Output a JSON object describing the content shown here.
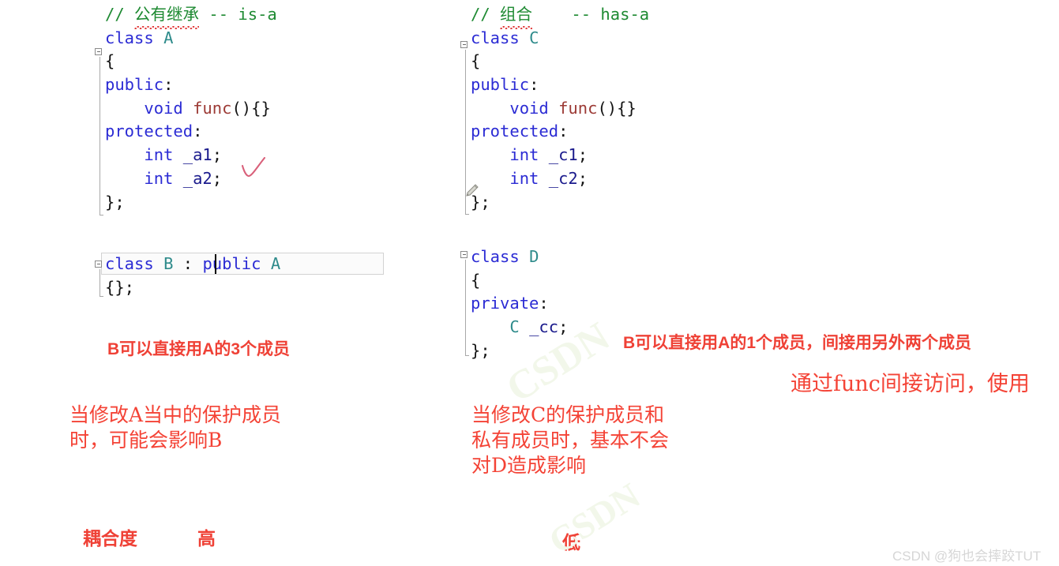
{
  "left_panel": {
    "class_a": {
      "lines": [
        {
          "indent": 0,
          "tokens": [
            {
              "t": "// ",
              "c": "comment"
            },
            {
              "t": "公有继承",
              "c": "comment",
              "squiggle": true
            },
            {
              "t": " -- is-a",
              "c": "comment"
            }
          ]
        },
        {
          "indent": 0,
          "tokens": [
            {
              "t": "class ",
              "c": "keyword"
            },
            {
              "t": "A",
              "c": "type"
            }
          ]
        },
        {
          "indent": 0,
          "tokens": [
            {
              "t": "{",
              "c": "punct"
            }
          ]
        },
        {
          "indent": 0,
          "tokens": [
            {
              "t": "public",
              "c": "keyword"
            },
            {
              "t": ":",
              "c": "punct"
            }
          ]
        },
        {
          "indent": 0,
          "tokens": [
            {
              "t": "    ",
              "c": "plain"
            },
            {
              "t": "void",
              "c": "keyword"
            },
            {
              "t": " ",
              "c": "plain"
            },
            {
              "t": "func",
              "c": "func"
            },
            {
              "t": "(){}",
              "c": "punct"
            }
          ]
        },
        {
          "indent": 0,
          "tokens": [
            {
              "t": "protected",
              "c": "keyword"
            },
            {
              "t": ":",
              "c": "punct"
            }
          ]
        },
        {
          "indent": 0,
          "tokens": [
            {
              "t": "    ",
              "c": "plain"
            },
            {
              "t": "int",
              "c": "keyword"
            },
            {
              "t": " ",
              "c": "plain"
            },
            {
              "t": "_a1",
              "c": "ident"
            },
            {
              "t": ";",
              "c": "punct"
            }
          ]
        },
        {
          "indent": 0,
          "tokens": [
            {
              "t": "    ",
              "c": "plain"
            },
            {
              "t": "int",
              "c": "keyword"
            },
            {
              "t": " ",
              "c": "plain"
            },
            {
              "t": "_a2",
              "c": "ident"
            },
            {
              "t": ";",
              "c": "punct"
            }
          ]
        },
        {
          "indent": 0,
          "tokens": [
            {
              "t": "};",
              "c": "punct"
            }
          ]
        }
      ]
    },
    "class_b": {
      "lines": [
        {
          "indent": 0,
          "tokens": [
            {
              "t": "class ",
              "c": "keyword"
            },
            {
              "t": "B",
              "c": "type"
            },
            {
              "t": " : ",
              "c": "punct"
            },
            {
              "t": "public",
              "c": "keyword"
            },
            {
              "t": " ",
              "c": "plain"
            },
            {
              "t": "A",
              "c": "type"
            }
          ]
        },
        {
          "indent": 0,
          "tokens": [
            {
              "t": "{};",
              "c": "punct"
            }
          ]
        }
      ],
      "caret_after": "p"
    },
    "annotation_members": "B可以直接用A的3个成员",
    "annotation_effect": "当修改A当中的保护成员\n时，可能会影响B",
    "coupling_label": "耦合度",
    "coupling_value": "高"
  },
  "right_panel": {
    "class_c": {
      "lines": [
        {
          "indent": 0,
          "tokens": [
            {
              "t": "// ",
              "c": "comment"
            },
            {
              "t": "组合",
              "c": "comment",
              "squiggle": true
            },
            {
              "t": "    -- has-a",
              "c": "comment"
            }
          ]
        },
        {
          "indent": 0,
          "tokens": [
            {
              "t": "class ",
              "c": "keyword"
            },
            {
              "t": "C",
              "c": "type"
            }
          ]
        },
        {
          "indent": 0,
          "tokens": [
            {
              "t": "{",
              "c": "punct"
            }
          ]
        },
        {
          "indent": 0,
          "tokens": [
            {
              "t": "public",
              "c": "keyword"
            },
            {
              "t": ":",
              "c": "punct"
            }
          ]
        },
        {
          "indent": 0,
          "tokens": [
            {
              "t": "    ",
              "c": "plain"
            },
            {
              "t": "void",
              "c": "keyword"
            },
            {
              "t": " ",
              "c": "plain"
            },
            {
              "t": "func",
              "c": "func"
            },
            {
              "t": "(){}",
              "c": "punct"
            }
          ]
        },
        {
          "indent": 0,
          "tokens": [
            {
              "t": "protected",
              "c": "keyword"
            },
            {
              "t": ":",
              "c": "punct"
            }
          ]
        },
        {
          "indent": 0,
          "tokens": [
            {
              "t": "    ",
              "c": "plain"
            },
            {
              "t": "int",
              "c": "keyword"
            },
            {
              "t": " ",
              "c": "plain"
            },
            {
              "t": "_c1",
              "c": "ident"
            },
            {
              "t": ";",
              "c": "punct"
            }
          ]
        },
        {
          "indent": 0,
          "tokens": [
            {
              "t": "    ",
              "c": "plain"
            },
            {
              "t": "int",
              "c": "keyword"
            },
            {
              "t": " ",
              "c": "plain"
            },
            {
              "t": "_c2",
              "c": "ident"
            },
            {
              "t": ";",
              "c": "punct"
            }
          ]
        },
        {
          "indent": 0,
          "tokens": [
            {
              "t": "};",
              "c": "punct"
            }
          ]
        }
      ]
    },
    "class_d": {
      "lines": [
        {
          "indent": 0,
          "tokens": [
            {
              "t": "class ",
              "c": "keyword"
            },
            {
              "t": "D",
              "c": "type"
            }
          ]
        },
        {
          "indent": 0,
          "tokens": [
            {
              "t": "{",
              "c": "punct"
            }
          ]
        },
        {
          "indent": 0,
          "tokens": [
            {
              "t": "private",
              "c": "keyword"
            },
            {
              "t": ":",
              "c": "punct"
            }
          ]
        },
        {
          "indent": 0,
          "tokens": [
            {
              "t": "    ",
              "c": "plain"
            },
            {
              "t": "C",
              "c": "type"
            },
            {
              "t": " ",
              "c": "plain"
            },
            {
              "t": "_cc",
              "c": "ident"
            },
            {
              "t": ";",
              "c": "punct"
            }
          ]
        },
        {
          "indent": 0,
          "tokens": [
            {
              "t": "};",
              "c": "punct"
            }
          ]
        }
      ]
    },
    "annotation_members": "B可以直接用A的1个成员，间接用另外两个成员",
    "annotation_access": "通过func间接访问，使用",
    "annotation_effect": "当修改C的保护成员和\n私有成员时，基本不会\n对D造成影响",
    "coupling_value": "低"
  },
  "watermarks": {
    "corner": "CSDN @狗也会摔跤TUT",
    "background": "CSDN"
  },
  "colors": {
    "comment": "#1e8a32",
    "keyword": "#2b2bd4",
    "type": "#2e8b8b",
    "function": "#9c3a35",
    "identifier": "#1a1a8c",
    "annotation_red": "#ef4136",
    "squiggle_red": "#e03c3c",
    "watermark_gray": "#d6d6d6"
  }
}
